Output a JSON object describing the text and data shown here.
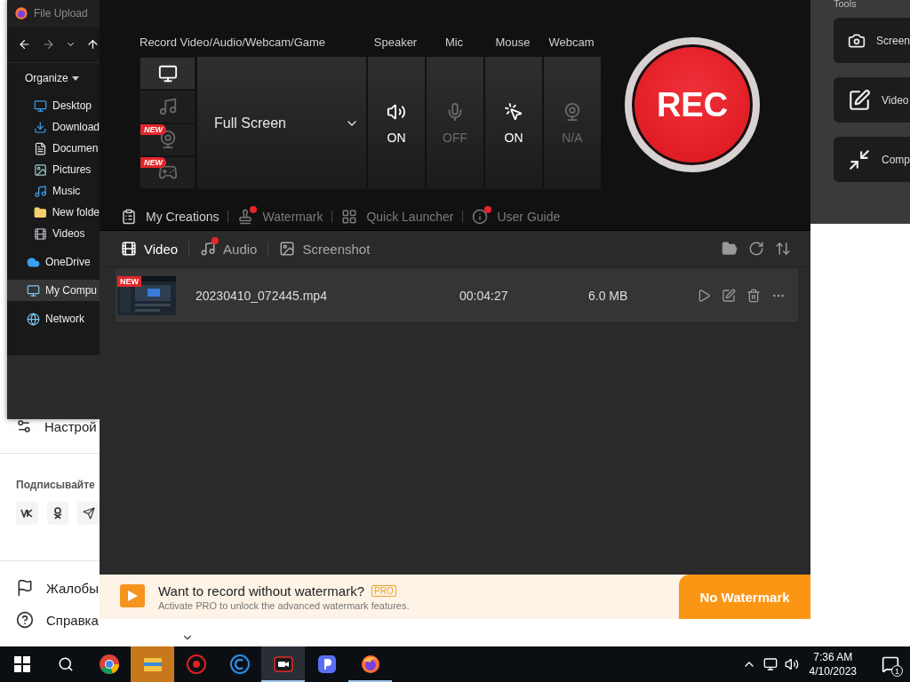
{
  "web_page": {
    "settings_link": "Настрой",
    "subscribe_heading": "Подписывайте",
    "links": [
      {
        "label": "Жалобы",
        "kind": "flag"
      },
      {
        "label": "Справка",
        "kind": "help"
      }
    ]
  },
  "tools_panel": {
    "title": "Tools",
    "tools": [
      {
        "label": "Screen",
        "kind": "camera"
      },
      {
        "label": "Video",
        "kind": "edit"
      },
      {
        "label": "Comp",
        "kind": "compress"
      }
    ]
  },
  "file_dialog": {
    "title": "File Upload",
    "toolbar": "Organize",
    "quick_access": [
      {
        "label": "Desktop",
        "kind": "desktop",
        "selected": false
      },
      {
        "label": "Download",
        "kind": "download",
        "selected": false
      },
      {
        "label": "Documen",
        "kind": "document",
        "selected": false
      },
      {
        "label": "Pictures",
        "kind": "pictures",
        "selected": false
      },
      {
        "label": "Music",
        "kind": "music",
        "selected": false
      },
      {
        "label": "New folde",
        "kind": "folder",
        "selected": false
      },
      {
        "label": "Videos",
        "kind": "videos",
        "selected": false
      }
    ],
    "locations": [
      {
        "label": "OneDrive",
        "kind": "cloud",
        "selected": false
      },
      {
        "label": "My Compu",
        "kind": "computer",
        "selected": true
      },
      {
        "label": "Network",
        "kind": "network",
        "selected": false
      }
    ]
  },
  "recorder": {
    "mode_label": "Record Video/Audio/Webcam/Game",
    "modes": [
      {
        "kind": "screen",
        "selected": true
      },
      {
        "kind": "audio",
        "selected": false
      },
      {
        "kind": "webcam",
        "selected": false,
        "badge": "NEW"
      },
      {
        "kind": "game",
        "selected": false,
        "badge": "NEW"
      }
    ],
    "area": "Full Screen",
    "devices": [
      {
        "label": "Speaker",
        "kind": "speaker",
        "status": "ON",
        "on": true
      },
      {
        "label": "Mic",
        "kind": "mic",
        "status": "OFF",
        "on": false
      },
      {
        "label": "Mouse",
        "kind": "mouse",
        "status": "ON",
        "on": true
      },
      {
        "label": "Webcam",
        "kind": "webcam",
        "status": "N/A",
        "on": false
      }
    ],
    "rec_button": "REC",
    "links": [
      {
        "label": "My Creations",
        "kind": "creations",
        "selected": true,
        "dot": false
      },
      {
        "label": "Watermark",
        "kind": "watermark",
        "selected": false,
        "dot": true
      },
      {
        "label": "Quick Launcher",
        "kind": "launcher",
        "selected": false,
        "dot": false
      },
      {
        "label": "User Guide",
        "kind": "guide",
        "selected": false,
        "dot": true
      }
    ],
    "media_tabs": [
      {
        "label": "Video",
        "kind": "video",
        "selected": true,
        "dot": false
      },
      {
        "label": "Audio",
        "kind": "audio",
        "selected": false,
        "dot": true
      },
      {
        "label": "Screenshot",
        "kind": "screenshot",
        "selected": false,
        "dot": false
      }
    ],
    "files": [
      {
        "badge": "NEW",
        "name": "20230410_072445.mp4",
        "duration": "00:04:27",
        "size": "6.0 MB"
      }
    ],
    "banner": {
      "title": "Want to record without watermark?",
      "tag": "PRO",
      "subtitle": "Activate PRO to unlock the advanced watermark features.",
      "button": "No Watermark"
    }
  },
  "taskbar": {
    "apps": [
      {
        "kind": "chrome",
        "flashing": false,
        "active": false,
        "running": false
      },
      {
        "kind": "explorer",
        "flashing": true,
        "active": false,
        "running": false
      },
      {
        "kind": "red-app",
        "flashing": false,
        "active": false,
        "running": false
      },
      {
        "kind": "c-app",
        "flashing": false,
        "active": false,
        "running": false
      },
      {
        "kind": "recorder",
        "flashing": false,
        "active": true,
        "running": true
      },
      {
        "kind": "p-app",
        "flashing": false,
        "active": false,
        "running": false
      },
      {
        "kind": "firefox",
        "flashing": false,
        "active": false,
        "running": true
      }
    ],
    "time": "7:36 AM",
    "date": "4/10/2023",
    "notifications": "1"
  }
}
